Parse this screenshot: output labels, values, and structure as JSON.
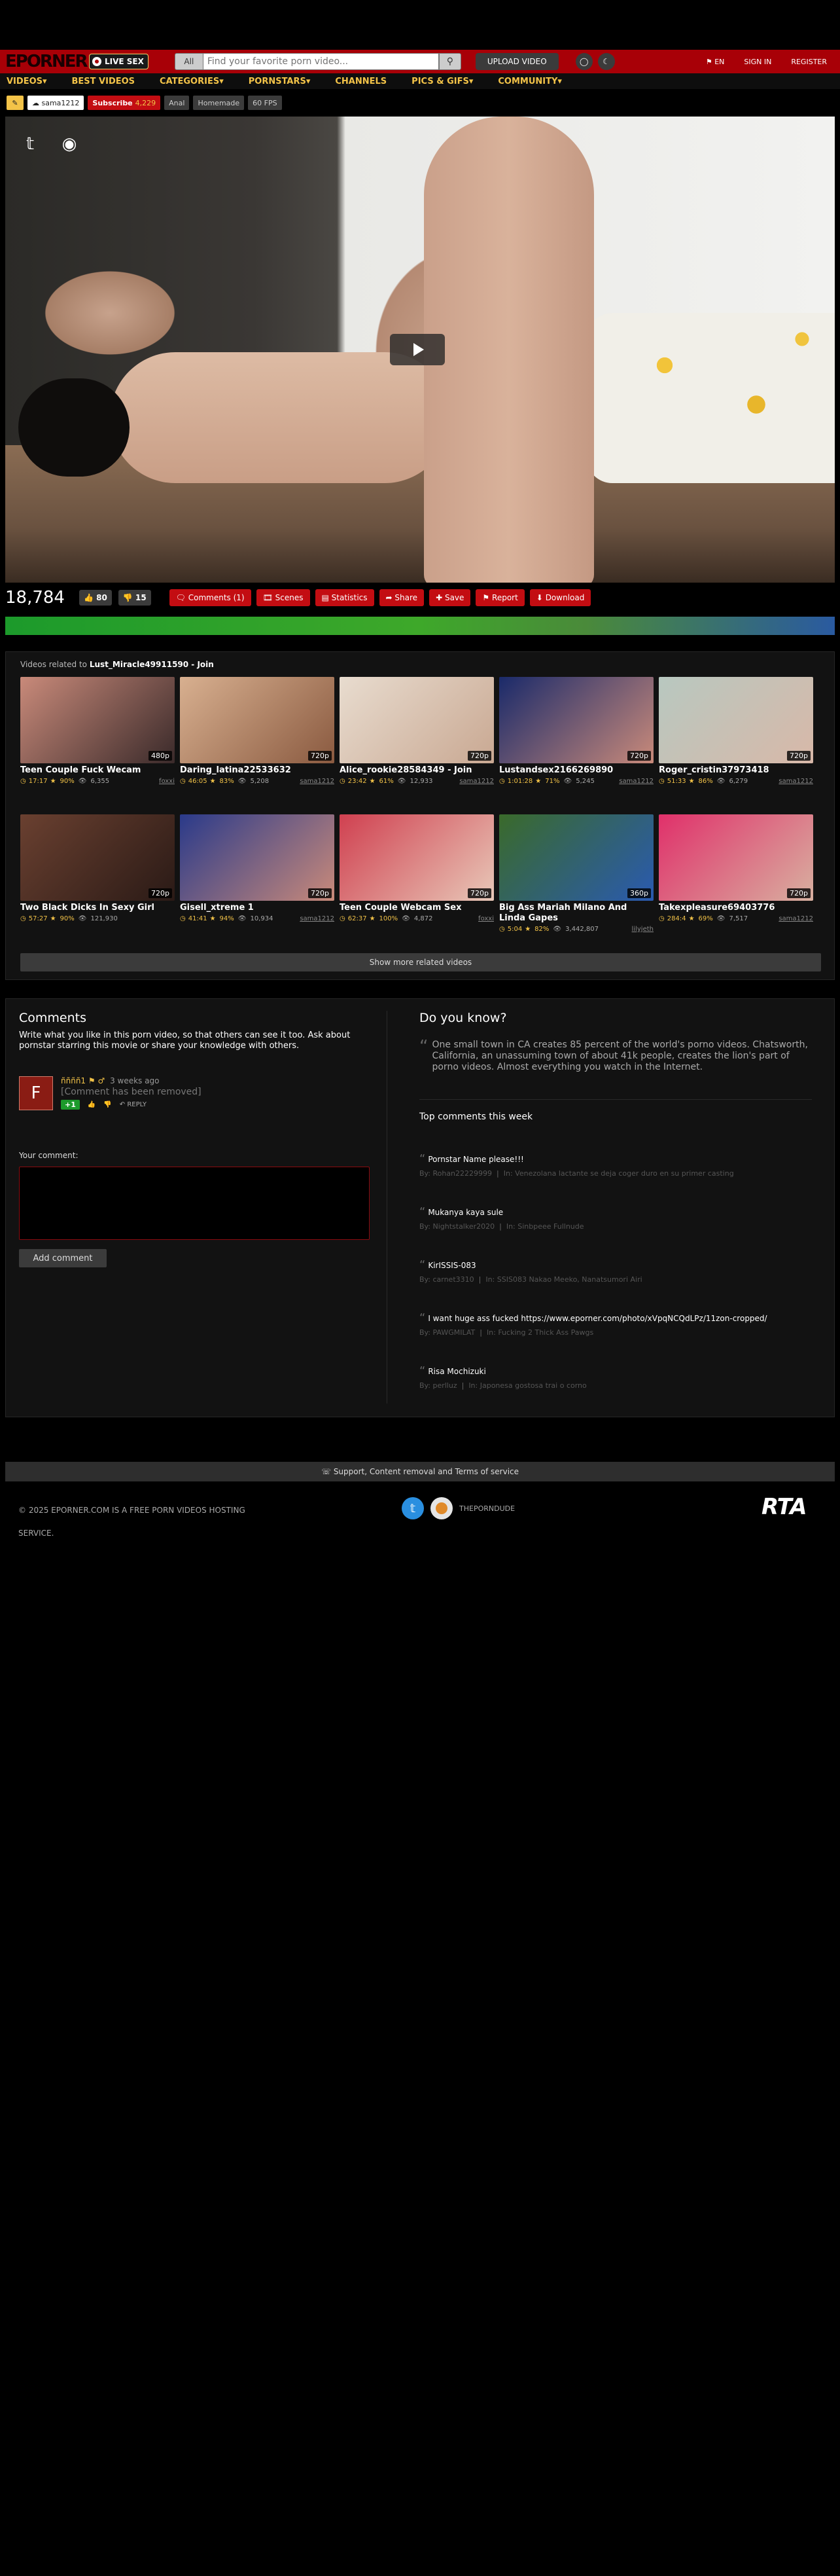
{
  "header": {
    "logo": "EPORNER",
    "live_sex": "LIVE SEX",
    "search_scope": "All",
    "search_placeholder": "Find your favorite porn video...",
    "upload_label": "UPLOAD VIDEO",
    "lang": "EN",
    "sign_in": "SIGN IN",
    "register": "REGISTER"
  },
  "nav": [
    "VIDEOS▾",
    "BEST VIDEOS",
    "CATEGORIES▾",
    "PORNSTARS▾",
    "CHANNELS",
    "PICS & GIFS▾",
    "COMMUNITY▾"
  ],
  "tags": {
    "uploader": "sama1212",
    "subscribe": "Subscribe",
    "subscribers": "4,229",
    "categories": [
      "Anal",
      "Homemade",
      "60 FPS"
    ]
  },
  "video": {
    "views": "18,784",
    "likes": "80",
    "dislikes": "15",
    "actions": [
      "Comments (1)",
      "Scenes",
      "Statistics",
      "Share",
      "Save",
      "Report",
      "Download"
    ]
  },
  "related": {
    "prefix": "Videos related to",
    "title": "Lust_Miracle49911590 - Join",
    "show_more": "Show more related videos",
    "videos": [
      {
        "title": "Teen Couple Fuck Wecam",
        "quality": "480p",
        "duration": "17:17",
        "rating": "90%",
        "views": "6,355",
        "uploader": "foxxi",
        "colors": [
          "#c98a7a",
          "#3a2a2a"
        ]
      },
      {
        "title": "Daring_latina22533632",
        "quality": "720p",
        "duration": "46:05",
        "rating": "83%",
        "views": "5,208",
        "uploader": "sama1212",
        "colors": [
          "#d8b090",
          "#8a5a40"
        ]
      },
      {
        "title": "Alice_rookie28584349 - Join",
        "quality": "720p",
        "duration": "23:42",
        "rating": "61%",
        "views": "12,933",
        "uploader": "sama1212",
        "colors": [
          "#e8dccf",
          "#c9a892"
        ]
      },
      {
        "title": "Lustandsex2166269890",
        "quality": "720p",
        "duration": "1:01:28",
        "rating": "71%",
        "views": "5,245",
        "uploader": "sama1212",
        "colors": [
          "#1a2a6a",
          "#c98a7a"
        ]
      },
      {
        "title": "Roger_cristin37973418",
        "quality": "720p",
        "duration": "51:33",
        "rating": "86%",
        "views": "6,279",
        "uploader": "sama1212",
        "colors": [
          "#b8c8c0",
          "#d8b8a8"
        ]
      },
      {
        "title": "Two Black Dicks In Sexy Girl",
        "quality": "720p",
        "duration": "57:27",
        "rating": "90%",
        "views": "121,930",
        "uploader": "",
        "colors": [
          "#6a4030",
          "#2a1a16"
        ]
      },
      {
        "title": "Gisell_xtreme 1",
        "quality": "720p",
        "duration": "41:41",
        "rating": "94%",
        "views": "10,934",
        "uploader": "sama1212",
        "colors": [
          "#2a3a8a",
          "#c98a7a"
        ]
      },
      {
        "title": "Teen Couple Webcam Sex",
        "quality": "720p",
        "duration": "62:37",
        "rating": "100%",
        "views": "4,872",
        "uploader": "foxxi",
        "colors": [
          "#d04050",
          "#e8c8b8"
        ]
      },
      {
        "title": "Big Ass Mariah Milano And Linda Gapes",
        "quality": "360p",
        "duration": "5:04",
        "rating": "82%",
        "views": "3,442,807",
        "uploader": "lilyjeth",
        "colors": [
          "#3a6a2a",
          "#2a5ab0"
        ]
      },
      {
        "title": "Takexpleasure69403776",
        "quality": "720p",
        "duration": "284:4",
        "rating": "69%",
        "views": "7,517",
        "uploader": "sama1212",
        "colors": [
          "#e0306a",
          "#d8b0a0"
        ]
      }
    ]
  },
  "comments": {
    "title": "Comments",
    "intro": "Write what you like in this porn video, so that others can see it too. Ask about pornstar starring this movie or share your knowledge with others.",
    "entries": [
      {
        "avatar": "F",
        "user": "ññññ1",
        "time": "3 weeks ago",
        "text": "[Comment has been removed]",
        "score": "+1",
        "reply": "REPLY"
      }
    ],
    "your_comment_label": "Your comment:",
    "add_button": "Add comment"
  },
  "did_you_know": {
    "title": "Do you know?",
    "text": "One small town in CA creates 85 percent of the world's porno videos. Chatsworth, California, an unassuming town of about 41k people, creates the lion's part of porno videos. Almost everything you watch in the Internet."
  },
  "top_comments": {
    "title": "Top comments this week",
    "items": [
      {
        "text": "Pornstar Name please!!!",
        "by": "Rohan22229999",
        "in": "Venezolana lactante se deja coger duro en su primer casting"
      },
      {
        "text": "Mukanya kaya sule",
        "by": "Nightstalker2020",
        "in": "Sinbpeee Fullnude"
      },
      {
        "text": "KirISSIS-083",
        "by": "carnet3310",
        "in": "SSIS083 Nakao Meeko, Nanatsumori Airi"
      },
      {
        "text": "I want huge ass fucked https://www.eporner.com/photo/xVpqNCQdLPz/11zon-cropped/",
        "by": "PAWGMILAT",
        "in": "Fucking 2 Thick Ass Pawgs"
      },
      {
        "text": "Risa Mochizuki",
        "by": "perlluz",
        "in": "Japonesa gostosa trai o corno"
      }
    ],
    "by_label": "By:",
    "in_label": "In:"
  },
  "footer": {
    "support": "Support, Content removal and Terms of service",
    "copyright": "© 2025 EPORNER.COM IS A FREE PORN VIDEOS HOSTING SERVICE.",
    "porndude": "THEPORNDUDE",
    "rta": "RTA"
  }
}
